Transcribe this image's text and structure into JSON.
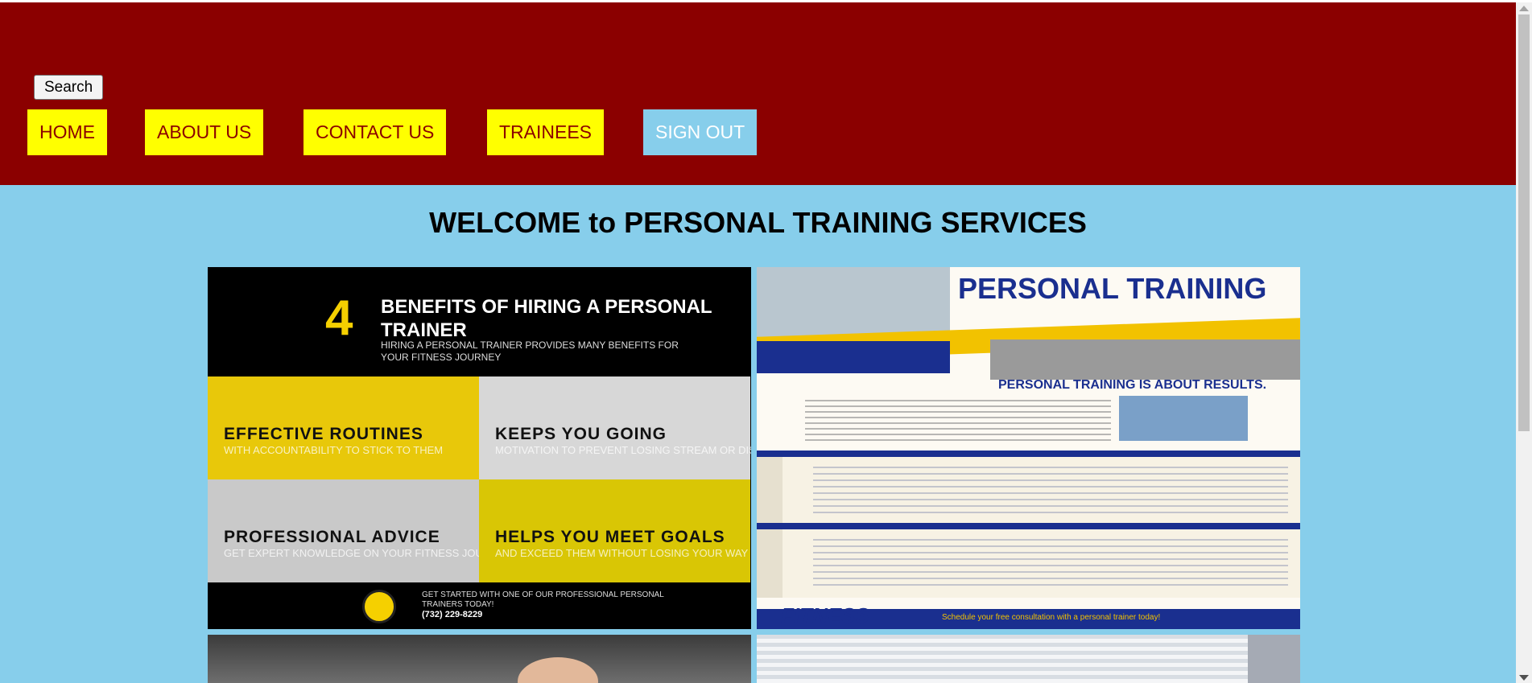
{
  "header": {
    "search_label": "Search",
    "nav": [
      {
        "label": "HOME"
      },
      {
        "label": "ABOUT US"
      },
      {
        "label": "CONTACT US"
      },
      {
        "label": "TRAINEES"
      },
      {
        "label": "SIGN OUT"
      }
    ]
  },
  "main": {
    "title": "WELCOME to PERSONAL TRAINING SERVICES"
  },
  "promo_left": {
    "number": "4",
    "heading": "BENEFITS OF HIRING A PERSONAL TRAINER",
    "subheading": "HIRING A PERSONAL TRAINER PROVIDES MANY BENEFITS FOR YOUR FITNESS JOURNEY",
    "benefits": [
      {
        "title": "EFFECTIVE ROUTINES",
        "desc": "WITH ACCOUNTABILITY TO STICK TO THEM"
      },
      {
        "title": "KEEPS YOU GOING",
        "desc": "MOTIVATION TO PREVENT LOSING STREAM OR DISCOURAGEMENT"
      },
      {
        "title": "PROFESSIONAL ADVICE",
        "desc": "GET EXPERT KNOWLEDGE ON YOUR FITNESS JOURNEY"
      },
      {
        "title": "HELPS YOU MEET GOALS",
        "desc": "AND EXCEED THEM WITHOUT LOSING YOUR WAY"
      }
    ],
    "footer_text": "GET STARTED WITH ONE OF OUR PROFESSIONAL PERSONAL TRAINERS TODAY!",
    "phone": "(732) 229-8229"
  },
  "promo_right": {
    "title": "PERSONAL TRAINING",
    "subtitle": "PERSONAL TRAINING IS ABOUT RESULTS.",
    "brand": "FITNESS",
    "footer_text": "Schedule your free consultation with a personal trainer today!"
  },
  "colors": {
    "header_bg": "#8b0000",
    "page_bg": "#87ceeb",
    "nav_bg": "#ffff00",
    "nav_text": "#8b0000",
    "signout_bg": "#87ceeb"
  }
}
